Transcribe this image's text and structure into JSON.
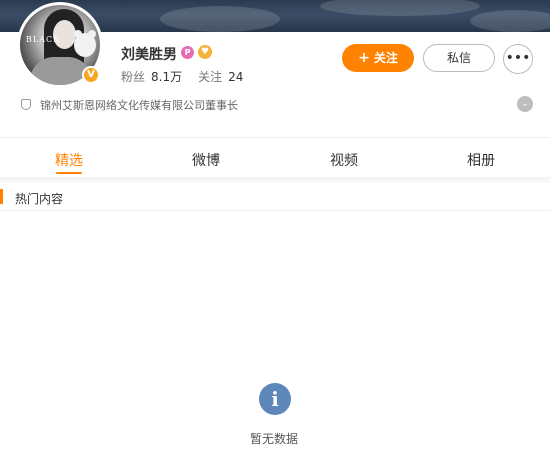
{
  "profile": {
    "name": "刘美胜男",
    "badge_p": "P",
    "badge_fan": "♥",
    "verified_mark": "V",
    "avatar_text": "BLACK",
    "stats": {
      "fans_label": "粉丝",
      "fans_count": "8.1万",
      "following_label": "关注",
      "following_count": "24"
    },
    "description": "锦州艾斯恩网络文化传媒有限公司董事长"
  },
  "actions": {
    "follow_plus": "+",
    "follow_label": "关注",
    "message_label": "私信",
    "more_label": "•••",
    "expand_label": "⌄"
  },
  "tabs": [
    {
      "label": "精选",
      "active": true
    },
    {
      "label": "微博",
      "active": false
    },
    {
      "label": "视频",
      "active": false
    },
    {
      "label": "相册",
      "active": false
    }
  ],
  "section": {
    "title": "热门内容"
  },
  "empty_state": {
    "icon_glyph": "i",
    "text": "暂无数据"
  },
  "colors": {
    "accent": "#ff8200",
    "info_icon": "#5d86b9"
  }
}
